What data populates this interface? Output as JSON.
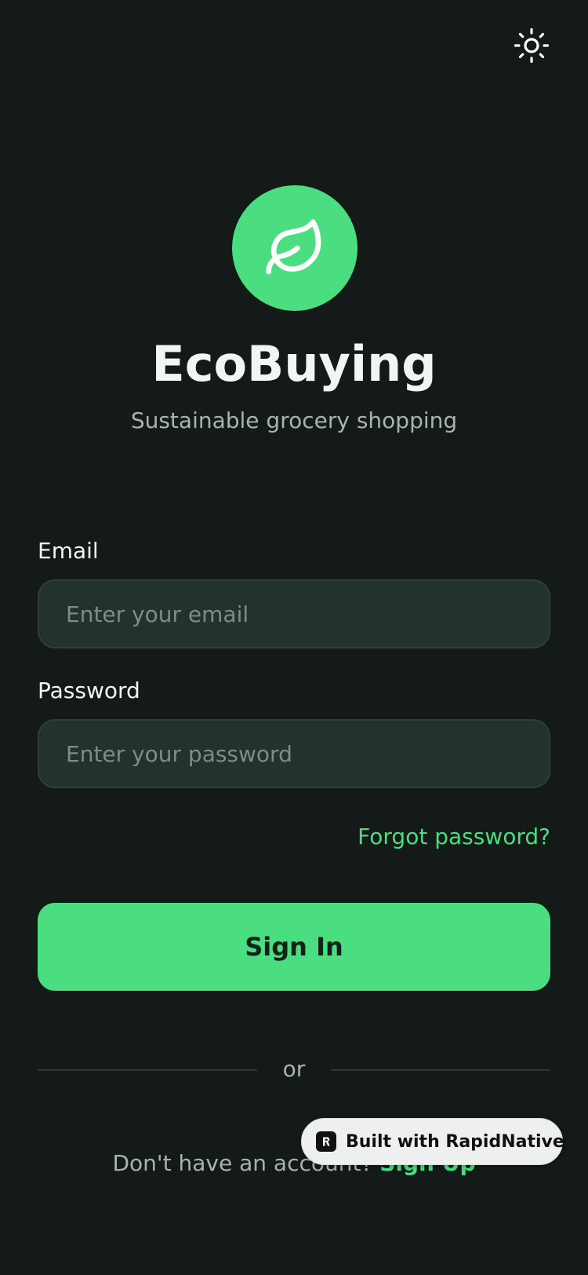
{
  "app": {
    "name": "EcoBuying",
    "tagline": "Sustainable grocery shopping"
  },
  "header": {
    "theme_toggle_icon": "sun-icon"
  },
  "logo": {
    "icon": "leaf-icon",
    "color": "#4ADE80"
  },
  "form": {
    "email": {
      "label": "Email",
      "placeholder": "Enter your email",
      "value": ""
    },
    "password": {
      "label": "Password",
      "placeholder": "Enter your password",
      "value": ""
    },
    "forgot_label": "Forgot password?",
    "submit_label": "Sign In"
  },
  "divider": {
    "label": "or"
  },
  "signup": {
    "prompt": "Don't have an account?",
    "link_label": "Sign Up"
  },
  "badge": {
    "icon": "rapidnative-logo-icon",
    "label": "Built with RapidNative"
  },
  "colors": {
    "background": "#131A17",
    "accent": "#4ADE80",
    "input_background": "#23332B",
    "input_border": "#2E4036",
    "text_primary": "#F2F5F3",
    "text_secondary": "#A9B3AD"
  }
}
